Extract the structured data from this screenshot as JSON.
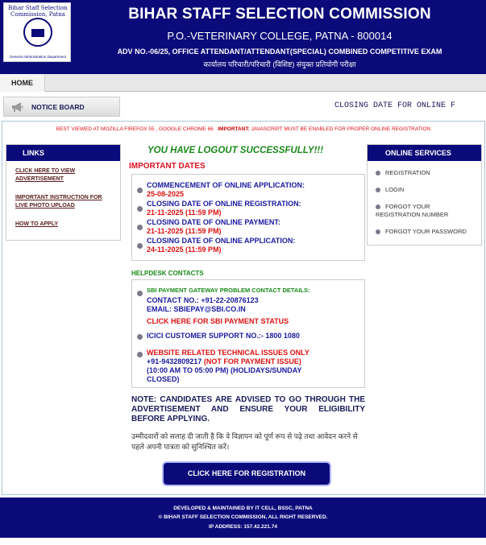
{
  "header": {
    "logo_arc_text": "Bihar Staff Selection Commission, Patna",
    "logo_dept": "General Administration Department",
    "title": "BIHAR STAFF SELECTION COMMISSION",
    "address": "P.O.-VETERINARY COLLEGE, PATNA - 800014",
    "advertisement": "ADV NO.-06/25, OFFICE ATTENDANT/ATTENDANT(SPECIAL) COMBINED COMPETITIVE EXAM",
    "hindi_title": "कार्यालय परिचारी/परिचारी (विशिष्ट) संयुक्त प्रतियोगी परीक्षा"
  },
  "menu": {
    "home": "HOME"
  },
  "notice": {
    "label": "NOTICE BOARD",
    "marquee": "CLOSING DATE FOR ONLINE F"
  },
  "tips": {
    "browser": "BEST VIEWED AT MOZILLA FIREFOX 55 , GOOGLE CHROME 66",
    "important_label": "IMPORTANT:",
    "important_text": "JAVASCRIPT MUST BE ENABLED FOR PROPER ONLINE REGISTRATION"
  },
  "links": {
    "heading": "LINKS",
    "items": [
      {
        "label": "CLICK HERE TO VIEW ADVERTISEMENT"
      },
      {
        "label": "IMPORTANT INSTRUCTION FOR LIVE PHOTO UPLOAD"
      },
      {
        "label": "HOW TO APPLY"
      }
    ]
  },
  "main": {
    "greeting": "YOU HAVE LOGOUT SUCCESSFULLY!!!",
    "important_dates_title": "IMPORTANT DATES",
    "dates": [
      {
        "label": "COMMENCEMENT OF ONLINE APPLICATION:",
        "value": "25-08-2025"
      },
      {
        "label": "CLOSING DATE OF ONLINE REGISTRATION:",
        "value": "21-11-2025 (11:59 PM)"
      },
      {
        "label": "CLOSING DATE OF ONLINE PAYMENT:",
        "value": "21-11-2025 (11:59 PM)"
      },
      {
        "label": "CLOSING DATE OF ONLINE APPLICATION:",
        "value": "24-11-2025 (11:59 PM)"
      }
    ],
    "helpdesk_title": "HELPDESK CONTACTS",
    "helpdesk": {
      "sbi_title": "SBI PAYMENT GATEWAY PROBLEM CONTACT DETAILS:",
      "sbi_contact": "CONTACT NO.: +91-22-20876123",
      "sbi_email": "EMAIL: SBIEPAY@SBI.CO.IN",
      "sbi_status_link": "CLICK HERE FOR SBI PAYMENT STATUS",
      "icici": "ICICI CUSTOMER SUPPORT NO.:- 1800 1080",
      "tech_title": "WEBSITE RELATED TECHNICAL ISSUES ONLY",
      "tech_phone": "+91-9432809217",
      "tech_not_payment": "(NOT FOR PAYMENT ISSUE)",
      "tech_hours": "(10:00 AM TO 05:00 PM) (HOLIDAYS/SUNDAY",
      "tech_closed": "CLOSED)"
    },
    "note": "NOTE: CANDIDATES ARE ADVISED TO GO THROUGH THE ADVERTISEMENT AND ENSURE YOUR ELIGIBILITY BEFORE APPLYING.",
    "hindi_note": "उम्मीदवारों को सलाह दी जाती है कि वे विज्ञापन को पूर्ण रूप से पढ़े तथा आवेदन करने से पहले अपनी पात्रता को सुनिश्चित करें।",
    "register_button": "CLICK HERE FOR REGISTRATION"
  },
  "services": {
    "heading": "ONLINE SERVICES",
    "items": [
      {
        "label": "REGISTRATION"
      },
      {
        "label": "LOGIN"
      },
      {
        "label": "FORGOT YOUR REGISTRATION NUMBER"
      },
      {
        "label": "FORGOT YOUR PASSWORD"
      }
    ]
  },
  "footer": {
    "developed": "DEVELOPED & MAINTAINED BY IT CELL, BSSC, PATNA",
    "copyright": "© BIHAR STAFF SELECTION COMMISSION, ALL RIGHT RESERVED.",
    "ip": "IP ADDRESS: 157.42.221.74"
  },
  "colors": {
    "brand_navy": "#0a0a7a",
    "success_green": "#1a8a1a",
    "alert_red": "#dd1111",
    "label_blue": "#1a1aa0"
  },
  "icons": [
    "megaphone-icon",
    "bullet-icon",
    "logo-emblem"
  ]
}
